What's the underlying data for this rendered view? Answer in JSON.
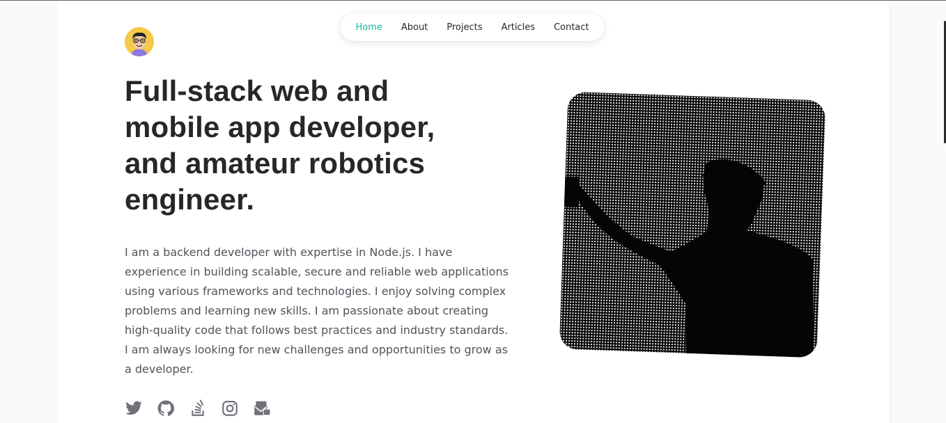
{
  "nav": {
    "items": [
      {
        "label": "Home",
        "active": true
      },
      {
        "label": "About",
        "active": false
      },
      {
        "label": "Projects",
        "active": false
      },
      {
        "label": "Articles",
        "active": false
      },
      {
        "label": "Contact",
        "active": false
      }
    ],
    "active_color": "#14b8a6"
  },
  "hero": {
    "headline": "Full-stack web and mobile app developer, and amateur robotics engineer.",
    "bio": "I am a backend developer with expertise in Node.js. I have experience in building scalable, secure and reliable web applications using various frameworks and technologies. I enjoy solving complex problems and learning new skills. I am passionate about creating high-quality code that follows best practices and industry standards. I am always looking for new challenges and opportunities to grow as a developer."
  },
  "socials": [
    {
      "icon": "twitter-icon"
    },
    {
      "icon": "github-icon"
    },
    {
      "icon": "stackoverflow-icon"
    },
    {
      "icon": "instagram-icon"
    },
    {
      "icon": "mail-icon"
    }
  ],
  "colors": {
    "text_primary": "#27272a",
    "text_secondary": "#52525b",
    "avatar_bg": "#f7c948"
  }
}
